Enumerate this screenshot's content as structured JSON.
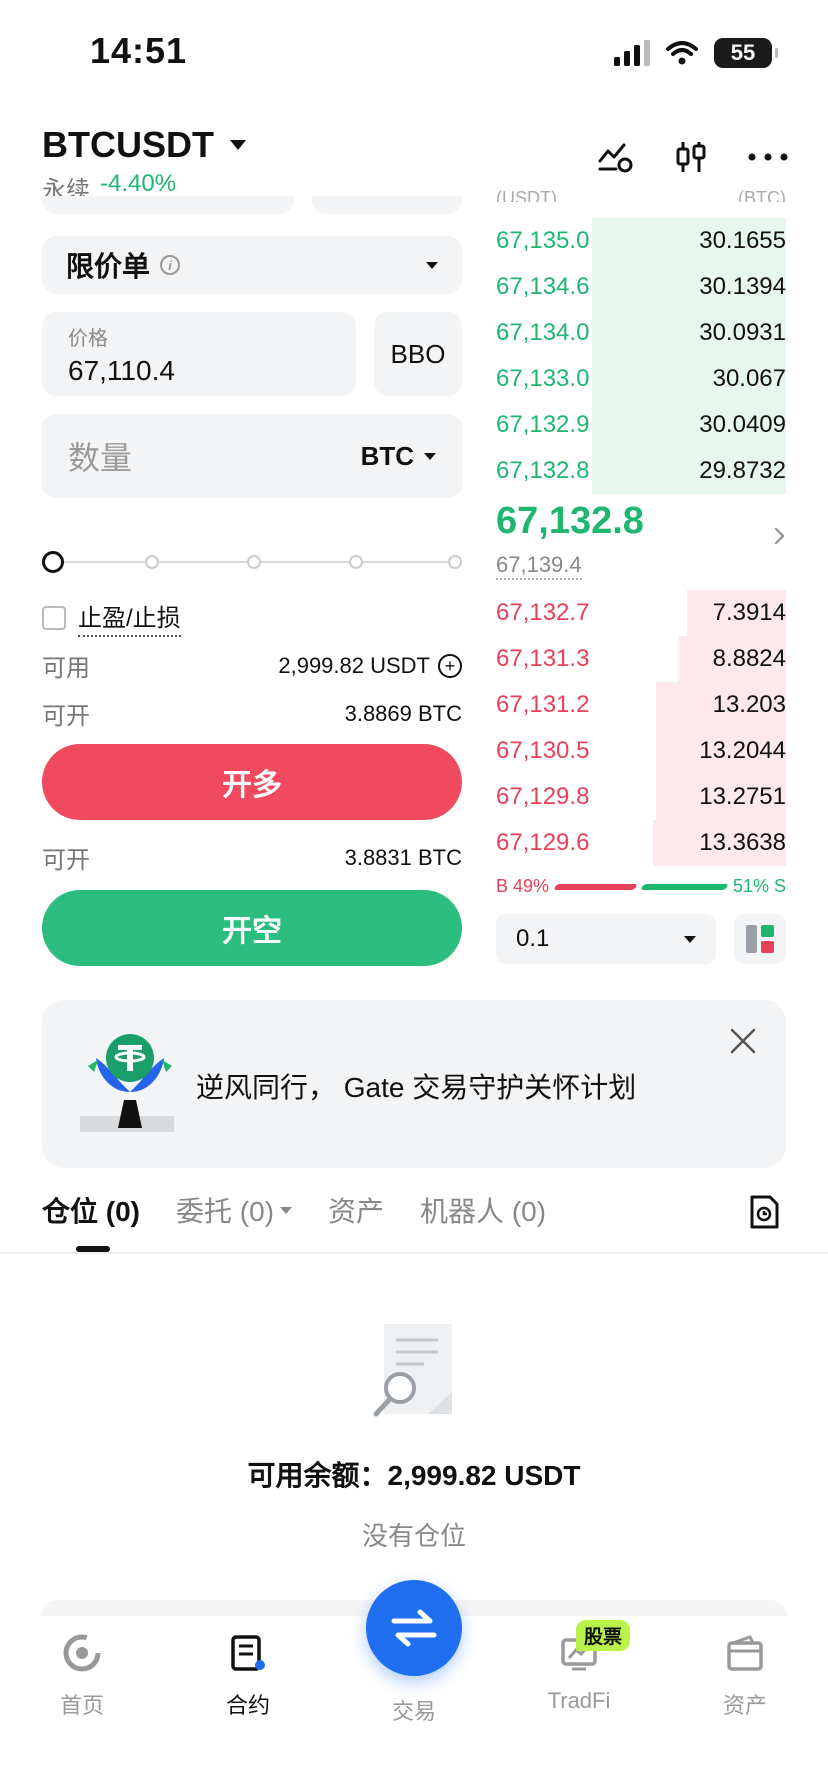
{
  "status": {
    "time": "14:51",
    "battery": "55"
  },
  "header": {
    "pair": "BTCUSDT",
    "type_label": "永续",
    "change": "-4.40%"
  },
  "order_form": {
    "order_type": "限价单",
    "price_label": "价格",
    "price_value": "67,110.4",
    "bbo_label": "BBO",
    "qty_placeholder": "数量",
    "qty_unit": "BTC",
    "leverage_slider_level": 0,
    "tpsl_label": "止盈/止损",
    "available_label": "可用",
    "available_value": "2,999.82 USDT",
    "open_long_label": "可开",
    "open_long_value": "3.8869 BTC",
    "long_button": "开多",
    "open_short_label": "可开",
    "open_short_value": "3.8831 BTC",
    "short_button": "开空"
  },
  "orderbook": {
    "header_price": "(USDT)",
    "header_qty": "(BTC)",
    "asks": [
      {
        "price": "67,135.0",
        "qty": "30.1655",
        "depth": 0.67
      },
      {
        "price": "67,134.6",
        "qty": "30.1394",
        "depth": 0.67
      },
      {
        "price": "67,134.0",
        "qty": "30.0931",
        "depth": 0.67
      },
      {
        "price": "67,133.0",
        "qty": "30.067",
        "depth": 0.67
      },
      {
        "price": "67,132.9",
        "qty": "30.0409",
        "depth": 0.67
      },
      {
        "price": "67,132.8",
        "qty": "29.8732",
        "depth": 0.67
      }
    ],
    "last_price": "67,132.8",
    "mark_price": "67,139.4",
    "bids": [
      {
        "price": "67,132.7",
        "qty": "7.3914",
        "depth": 0.34
      },
      {
        "price": "67,131.3",
        "qty": "8.8824",
        "depth": 0.37
      },
      {
        "price": "67,131.2",
        "qty": "13.203",
        "depth": 0.45
      },
      {
        "price": "67,130.5",
        "qty": "13.2044",
        "depth": 0.45
      },
      {
        "price": "67,129.8",
        "qty": "13.2751",
        "depth": 0.45
      },
      {
        "price": "67,129.6",
        "qty": "13.3638",
        "depth": 0.46
      }
    ],
    "buy_ratio": "B 49%",
    "sell_ratio": "51% S",
    "depth_step": "0.1"
  },
  "banner": {
    "text": "逆风同行， Gate 交易守护关怀计划"
  },
  "tabs": [
    {
      "label": "仓位 (0)"
    },
    {
      "label": "委托 (0)"
    },
    {
      "label": "资产"
    },
    {
      "label": "机器人 (0)"
    }
  ],
  "empty_state": {
    "balance": "可用余额：2,999.82 USDT",
    "message": "没有仓位"
  },
  "bottom_nav": {
    "home": "首页",
    "futures": "合约",
    "trade": "交易",
    "tradfi": "TradFi",
    "tradfi_badge": "股票",
    "assets": "资产"
  },
  "colors": {
    "green": "#1fb66f",
    "red": "#e8405a",
    "accent_blue": "#1f6ff0"
  }
}
